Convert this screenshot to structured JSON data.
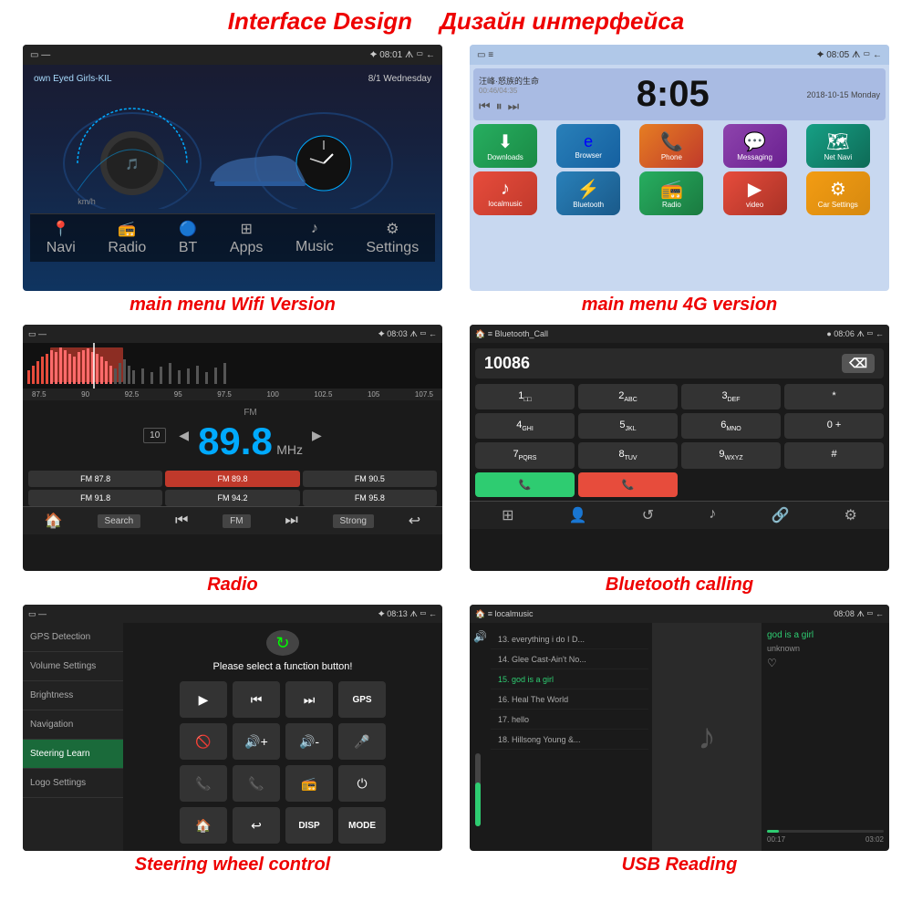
{
  "page": {
    "title_en": "Interface Design",
    "title_ru": "Дизайн интерфейса"
  },
  "screen1": {
    "caption": "main menu Wifi Version",
    "status_time": "08:01",
    "song": "own Eyed Girls-KIL",
    "date": "8/1 Wednesday",
    "nav_items": [
      "Navi",
      "Radio",
      "BT",
      "Apps",
      "Music",
      "Settings"
    ]
  },
  "screen2": {
    "caption": "main menu 4G version",
    "status_time": "08:05",
    "time_display": "8:05",
    "date": "2018-10-15 Monday",
    "icons": [
      "Downloads",
      "Browser",
      "Phone",
      "Messaging",
      "Net Navi",
      "localmusic",
      "Bluetooth",
      "Radio",
      "video",
      "Car Settings"
    ]
  },
  "screen3": {
    "caption": "Radio",
    "status_time": "08:03",
    "frequency": "89.8",
    "unit": "MHz",
    "band": "FM",
    "presets": [
      "FM 87.8",
      "FM 89.8",
      "FM 90.5",
      "FM 91.8",
      "FM 94.2",
      "FM 95.8"
    ],
    "scale": [
      "87.5",
      "90",
      "92.5",
      "95",
      "97.5",
      "100",
      "102.5",
      "105",
      "107.5"
    ]
  },
  "screen4": {
    "caption": "Bluetooth calling",
    "status_time": "08:06",
    "header": "Bluetooth_Call",
    "number": "10086",
    "keys": [
      "1",
      "2 ABC",
      "3 DEF",
      "*",
      "4 GHI",
      "5 JKL",
      "6 MNO",
      "0 +",
      "7 PQRS",
      "8 TUV",
      "9 WXYZ",
      "#"
    ]
  },
  "screen5": {
    "caption": "Steering wheel control",
    "status_time": "08:13",
    "prompt": "Please select a function button!",
    "sidebar_items": [
      "GPS Detection",
      "Volume Settings",
      "Brightness",
      "Navigation",
      "Steering Learn",
      "Logo Settings"
    ],
    "active_item": "Steering Learn",
    "button_labels": [
      "▶",
      "⏮",
      "⏭",
      "GPS",
      "🚫",
      "🔊+",
      "🔊-",
      "🎤",
      "📞",
      "📞",
      "📻",
      "⏻",
      "🏠",
      "↩",
      "DISP",
      "MODE"
    ]
  },
  "screen6": {
    "caption": "USB Reading",
    "status_time": "08:08",
    "track_current": "god is a girl",
    "track_artist": "unknown",
    "time_current": "00:17",
    "time_total": "03:02",
    "tracks": [
      "13. everything i do I D...",
      "14. Glee Cast-Ain't No...",
      "15. god is a girl",
      "16. Heal The World",
      "17. hello",
      "18. Hillsong Young &..."
    ],
    "right_items": [
      "god is a girl",
      "unknown",
      "♡"
    ]
  }
}
